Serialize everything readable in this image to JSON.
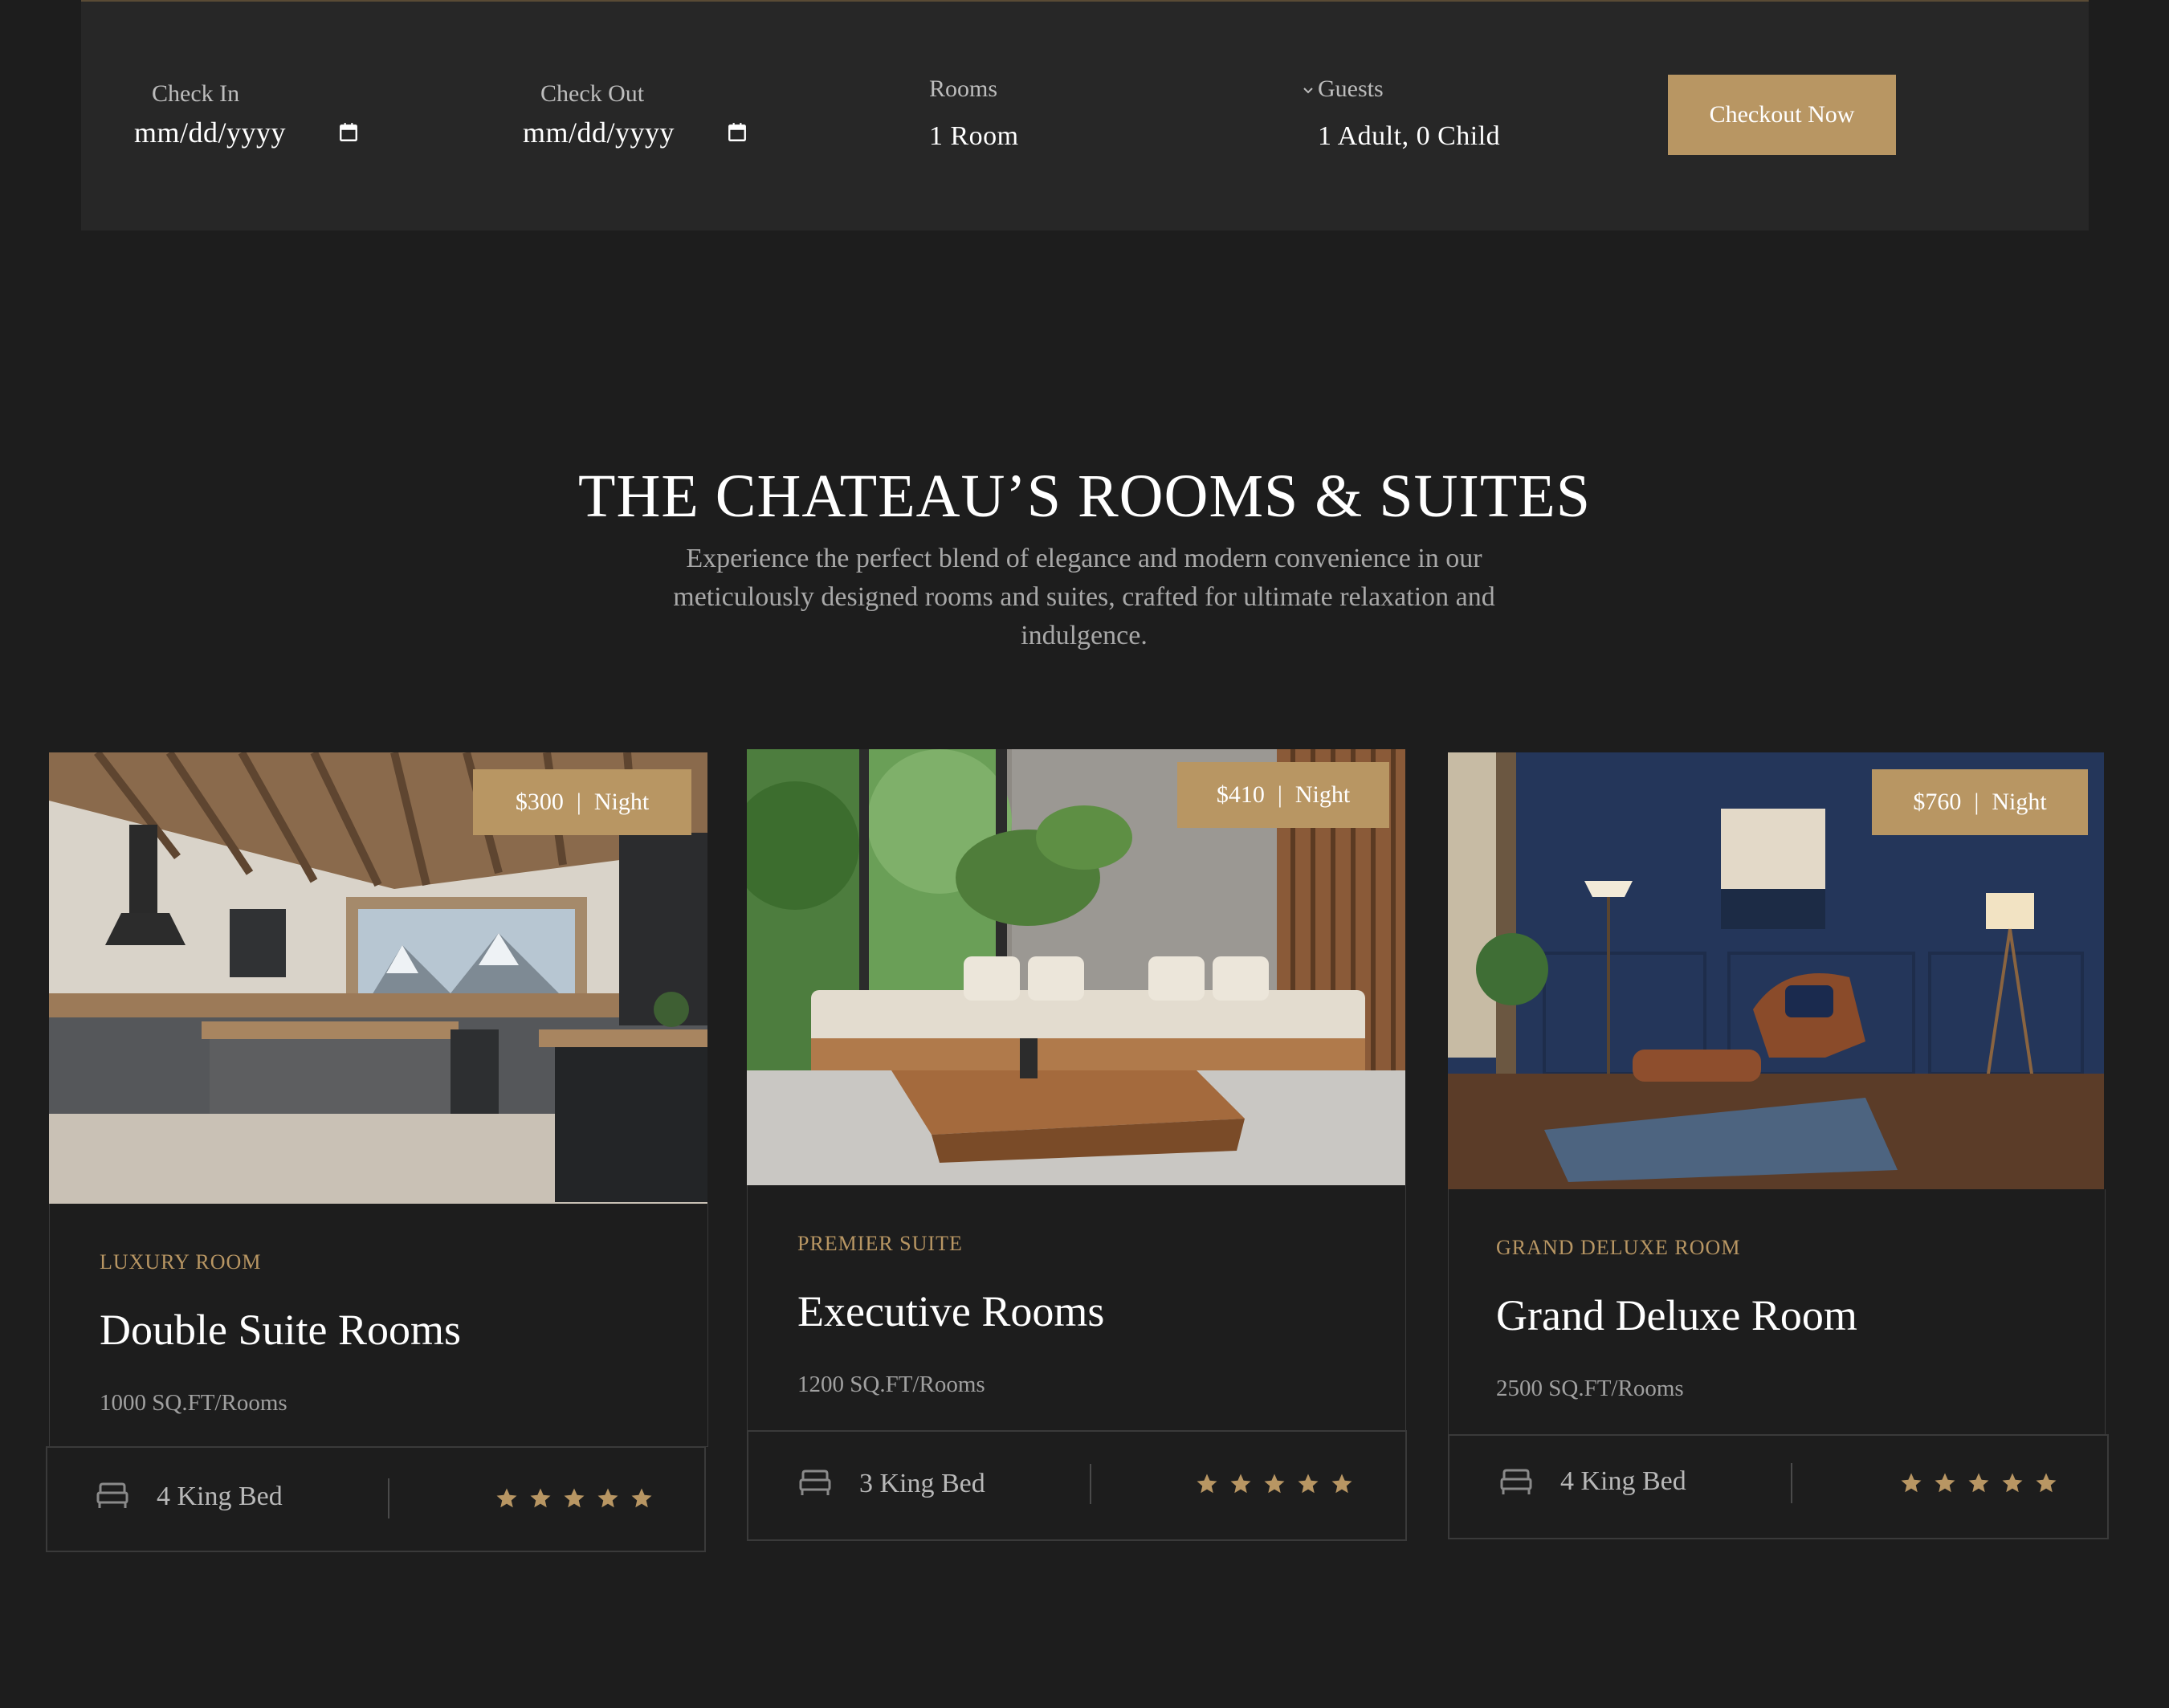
{
  "booking": {
    "check_in_label": "Check In",
    "check_in_value": "mm/dd/yyyy",
    "check_out_label": "Check Out",
    "check_out_value": "mm/dd/yyyy",
    "rooms_label": "Rooms",
    "rooms_value": "1 Room",
    "guests_label": "Guests",
    "guests_value": "1 Adult, 0 Child",
    "checkout_button": "Checkout Now"
  },
  "section": {
    "title": "THE CHATEAU’S ROOMS & SUITES",
    "subtitle_line1": "Experience the perfect blend of elegance and modern convenience in our",
    "subtitle_line2": "meticulously designed rooms and suites, crafted for ultimate relaxation and",
    "subtitle_line3": "indulgence."
  },
  "cards": [
    {
      "price": "$300",
      "price_unit": "Night",
      "category": "LUXURY ROOM",
      "title": "Double Suite Rooms",
      "size": "1000 SQ.FT/Rooms",
      "beds": "4 King Bed",
      "rating": 5
    },
    {
      "price": "$410",
      "price_unit": "Night",
      "category": "PREMIER SUITE",
      "title": "Executive Rooms",
      "size": "1200 SQ.FT/Rooms",
      "beds": "3 King Bed",
      "rating": 5
    },
    {
      "price": "$760",
      "price_unit": "Night",
      "category": "GRAND DELUXE ROOM",
      "title": "Grand Deluxe Room",
      "size": "2500 SQ.FT/Rooms",
      "beds": "4 King Bed",
      "rating": 5
    }
  ],
  "colors": {
    "background": "#1d1d1d",
    "panel": "#272727",
    "accent_gold": "#b89663"
  }
}
